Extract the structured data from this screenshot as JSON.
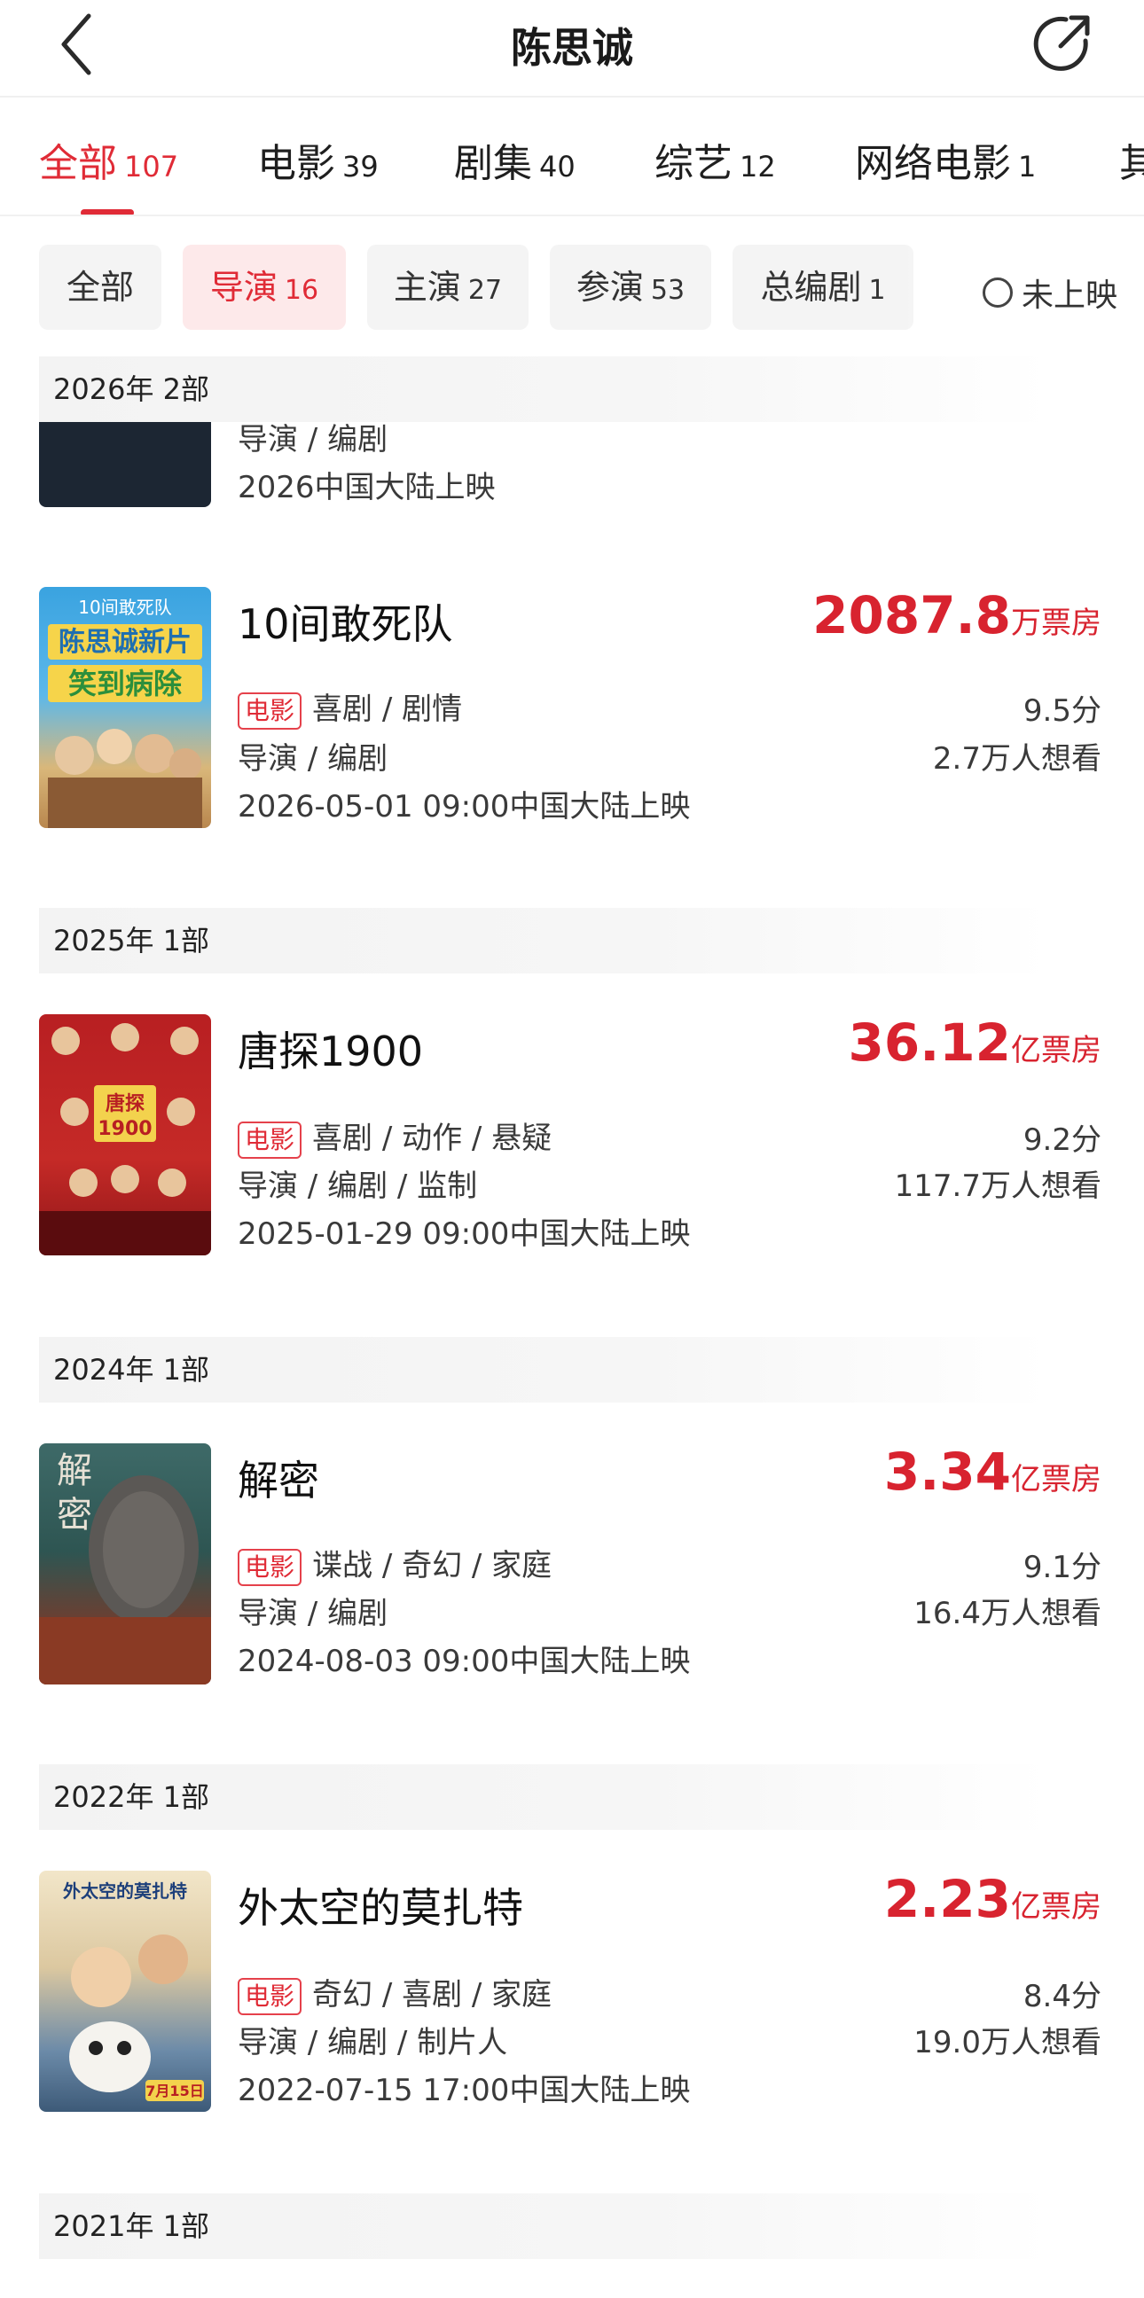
{
  "header": {
    "title": "陈思诚"
  },
  "category_tabs": [
    {
      "label": "全部",
      "count": "107"
    },
    {
      "label": "电影",
      "count": "39"
    },
    {
      "label": "剧集",
      "count": "40"
    },
    {
      "label": "综艺",
      "count": "12"
    },
    {
      "label": "网络电影",
      "count": "1"
    },
    {
      "label": "其",
      "count": ""
    }
  ],
  "role_filters": [
    {
      "label": "全部",
      "count": ""
    },
    {
      "label": "导演",
      "count": "16"
    },
    {
      "label": "主演",
      "count": "27"
    },
    {
      "label": "参演",
      "count": "53"
    },
    {
      "label": "总编剧",
      "count": "1"
    }
  ],
  "unreleased_label": "未上映",
  "partial_item": {
    "roles": "导演 / 编剧",
    "release": "2026中国大陆上映"
  },
  "years": [
    {
      "label": "2026年  2部"
    },
    {
      "label": "2025年  1部"
    },
    {
      "label": "2024年  1部"
    },
    {
      "label": "2022年  1部"
    },
    {
      "label": "2021年  1部"
    }
  ],
  "movies": [
    {
      "title": "10间敢死队",
      "box_value": "2087.8",
      "box_unit": "万票房",
      "tag": "电影",
      "genres": "喜剧 / 剧情",
      "roles": "导演 / 编剧",
      "release": "2026-05-01 09:00中国大陆上映",
      "score": "9.5分",
      "wish": "2.7万人想看",
      "poster_text": [
        "10间敢死队",
        "陈思诚新片",
        "笑到病除"
      ]
    },
    {
      "title": "唐探1900",
      "box_value": "36.12",
      "box_unit": "亿票房",
      "tag": "电影",
      "genres": "喜剧 / 动作 / 悬疑",
      "roles": "导演 / 编剧 / 监制",
      "release": "2025-01-29 09:00中国大陆上映",
      "score": "9.2分",
      "wish": "117.7万人想看",
      "poster_text": [
        "唐探",
        "1900"
      ]
    },
    {
      "title": "解密",
      "box_value": "3.34",
      "box_unit": "亿票房",
      "tag": "电影",
      "genres": "谍战 / 奇幻 / 家庭",
      "roles": "导演 / 编剧",
      "release": "2024-08-03 09:00中国大陆上映",
      "score": "9.1分",
      "wish": "16.4万人想看",
      "poster_text": [
        "解",
        "密"
      ]
    },
    {
      "title": "外太空的莫扎特",
      "box_value": "2.23",
      "box_unit": "亿票房",
      "tag": "电影",
      "genres": "奇幻 / 喜剧 / 家庭",
      "roles": "导演 / 编剧 / 制片人",
      "release": "2022-07-15 17:00中国大陆上映",
      "score": "8.4分",
      "wish": "19.0万人想看",
      "poster_text": [
        "外太空的莫扎特",
        "7月15日"
      ]
    }
  ],
  "colors": {
    "accent": "#e02b36",
    "chip_bg": "#f4f4f4",
    "chip_active_bg": "#fde9ea"
  }
}
